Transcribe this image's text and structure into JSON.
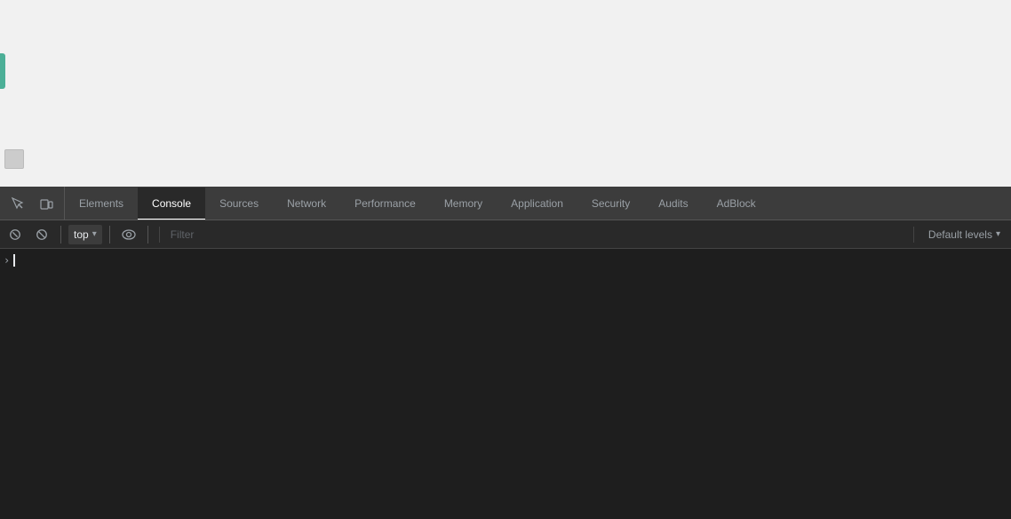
{
  "viewport": {
    "background": "#f1f1f1"
  },
  "devtools": {
    "tabs": [
      {
        "id": "elements",
        "label": "Elements",
        "active": false
      },
      {
        "id": "console",
        "label": "Console",
        "active": true
      },
      {
        "id": "sources",
        "label": "Sources",
        "active": false
      },
      {
        "id": "network",
        "label": "Network",
        "active": false
      },
      {
        "id": "performance",
        "label": "Performance",
        "active": false
      },
      {
        "id": "memory",
        "label": "Memory",
        "active": false
      },
      {
        "id": "application",
        "label": "Application",
        "active": false
      },
      {
        "id": "security",
        "label": "Security",
        "active": false
      },
      {
        "id": "audits",
        "label": "Audits",
        "active": false
      },
      {
        "id": "adblock",
        "label": "AdBlock",
        "active": false
      }
    ],
    "toolbar": {
      "context": "top",
      "context_chevron": "▾",
      "filter_placeholder": "Filter",
      "levels_label": "Default levels",
      "levels_chevron": "▾"
    }
  }
}
